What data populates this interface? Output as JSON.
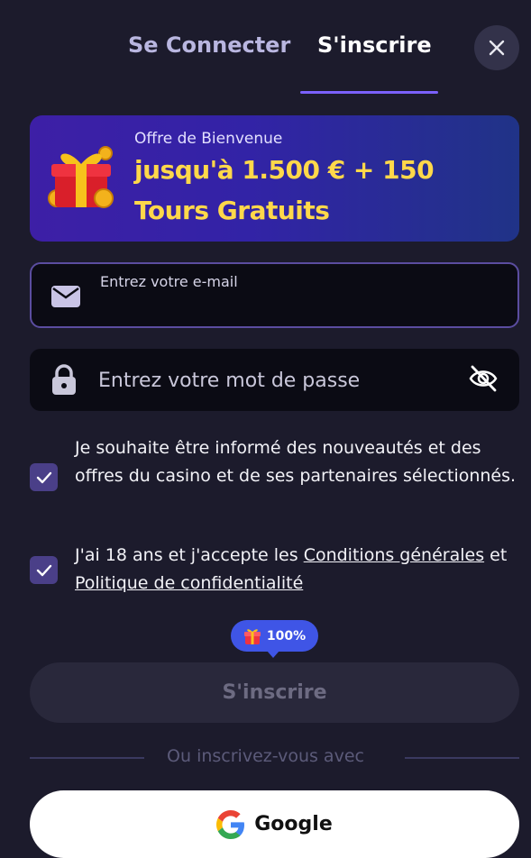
{
  "tabs": {
    "login": "Se Connecter",
    "register": "S'inscrire"
  },
  "promo": {
    "kicker": "Offre de Bienvenue",
    "line1": "jusqu'à 1.500 € + 150",
    "line2": "Tours Gratuits"
  },
  "email": {
    "label": "Entrez votre e-mail",
    "value": ""
  },
  "password": {
    "placeholder": "Entrez votre mot de passe"
  },
  "consent": {
    "marketing": "Je souhaite être informé des nouveautés et des offres du casino et de ses partenaires sélectionnés.",
    "terms_prefix": "J'ai 18 ans et j'accepte les ",
    "terms_link": "Conditions générales",
    "terms_and": " et ",
    "privacy_link": "Politique de confidentialité"
  },
  "badge": {
    "label": "100%"
  },
  "submit": {
    "label": "S'inscrire"
  },
  "divider": {
    "label": "Ou inscrivez-vous avec"
  },
  "google": {
    "label": "Google"
  },
  "colors": {
    "accent": "#7b61ff",
    "promo_text": "#ffd84a",
    "checkbox": "#4a3f88",
    "badge": "#3f55e6"
  },
  "icons": [
    "close-icon",
    "gift-icon",
    "mail-icon",
    "lock-icon",
    "eye-off-icon",
    "check-icon",
    "google-icon"
  ]
}
